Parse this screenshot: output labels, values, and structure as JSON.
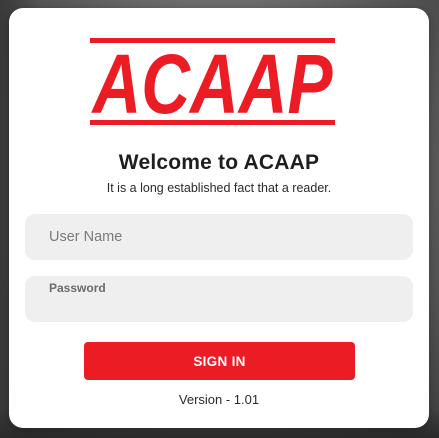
{
  "logo": {
    "text": "ACAAP",
    "color": "#ec1c24"
  },
  "login": {
    "title": "Welcome to ACAAP",
    "subtitle": "It is a long established fact that a reader.",
    "username_placeholder": "User Name",
    "password_label": "Password",
    "signin_label": "SIGN IN",
    "version": "Version - 1.01"
  },
  "colors": {
    "accent": "#ec1c24",
    "field_bg": "#efefef",
    "card_bg": "#ffffff"
  }
}
